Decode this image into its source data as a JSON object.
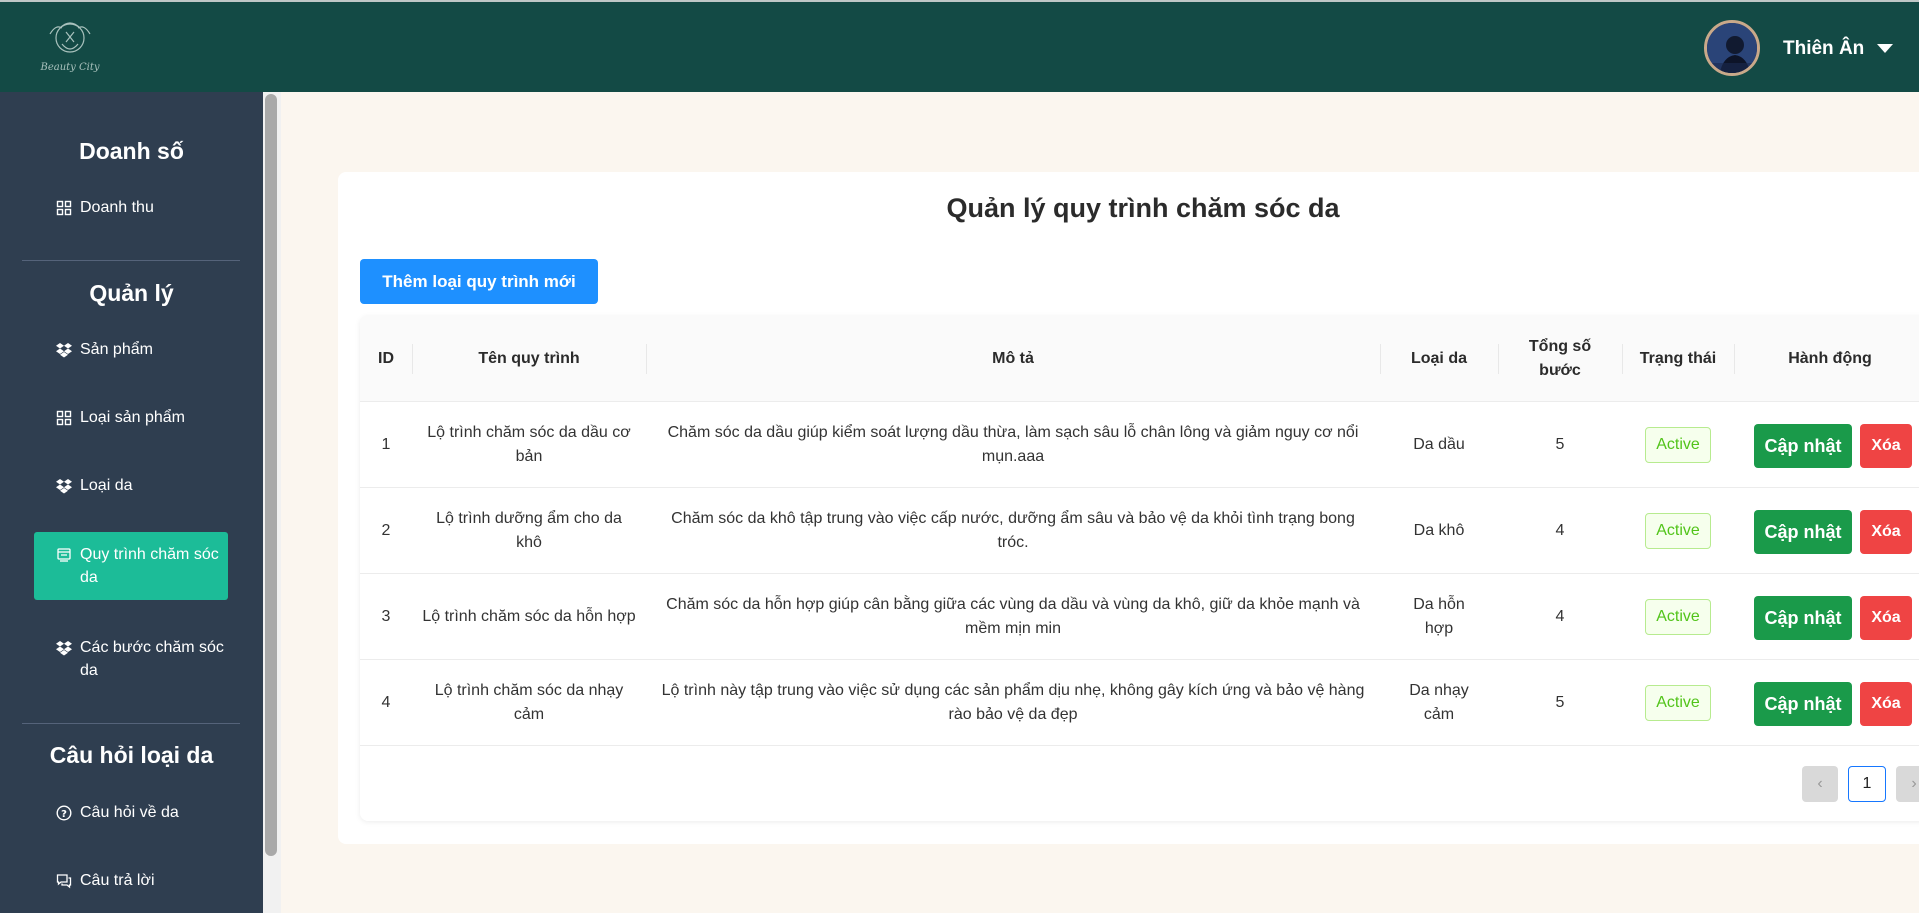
{
  "header": {
    "logo_alt": "Beauty City",
    "user_name": "Thiên Ân"
  },
  "sidebar": {
    "sections": [
      {
        "title": "Doanh số",
        "items": [
          {
            "label": "Doanh thu",
            "icon": "grid-icon"
          }
        ]
      },
      {
        "title": "Quản lý",
        "items": [
          {
            "label": "Sản phẩm",
            "icon": "dropbox-icon"
          },
          {
            "label": "Loại sản phẩm",
            "icon": "grid-icon"
          },
          {
            "label": "Loại da",
            "icon": "dropbox-icon"
          },
          {
            "label": "Quy trình chăm sóc da",
            "icon": "process-icon",
            "active": true
          },
          {
            "label": "Các bước chăm sóc da",
            "icon": "dropbox-icon"
          }
        ]
      },
      {
        "title": "Câu hỏi loại da",
        "items": [
          {
            "label": "Câu hỏi về da",
            "icon": "question-icon"
          },
          {
            "label": "Câu trả lời",
            "icon": "chat-icon"
          }
        ]
      }
    ]
  },
  "main": {
    "title": "Quản lý quy trình chăm sóc da",
    "add_button": "Thêm loại quy trình mới",
    "columns": [
      "ID",
      "Tên quy trình",
      "Mô tả",
      "Loại da",
      "Tổng số bước",
      "Trạng thái",
      "Hành động"
    ],
    "rows": [
      {
        "id": "1",
        "name": "Lộ trình chăm sóc da dầu cơ bản",
        "desc": "Chăm sóc da dầu giúp kiểm soát lượng dầu thừa, làm sạch sâu lỗ chân lông và giảm nguy cơ nổi mụn.aaa",
        "skin": "Da dầu",
        "steps": "5",
        "status": "Active"
      },
      {
        "id": "2",
        "name": "Lộ trình dưỡng ẩm cho da khô",
        "desc": "Chăm sóc da khô tập trung vào việc cấp nước, dưỡng ẩm sâu và bảo vệ da khỏi tình trạng bong tróc.",
        "skin": "Da khô",
        "steps": "4",
        "status": "Active"
      },
      {
        "id": "3",
        "name": "Lộ trình chăm sóc da hỗn hợp",
        "desc": "Chăm sóc da hỗn hợp giúp cân bằng giữa các vùng da dầu và vùng da khô, giữ da khỏe mạnh và mềm mịn min",
        "skin": "Da hỗn hợp",
        "steps": "4",
        "status": "Active"
      },
      {
        "id": "4",
        "name": "Lộ trình chăm sóc da nhạy cảm",
        "desc": "Lộ trình này tập trung vào việc sử dụng các sản phẩm dịu nhẹ, không gây kích ứng và bảo vệ hàng rào bảo vệ da đẹp",
        "skin": "Da nhạy cảm",
        "steps": "5",
        "status": "Active"
      }
    ],
    "update_label": "Cập nhật",
    "delete_label": "Xóa",
    "pagination": {
      "prev": "‹",
      "current": "1",
      "next": "›"
    }
  },
  "colors": {
    "header_bg": "#134a45",
    "sidebar_bg": "#2f3e50",
    "active_item": "#1cbc98",
    "primary": "#1e90ff",
    "update_btn": "#1a9a4a",
    "delete_btn": "#ef4444"
  }
}
